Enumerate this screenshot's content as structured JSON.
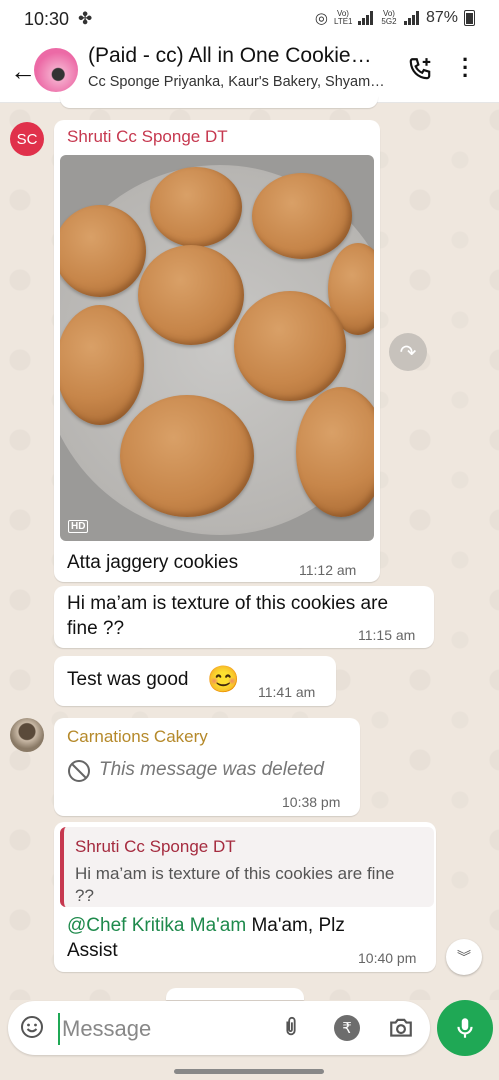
{
  "status_bar": {
    "time": "10:30",
    "battery": "87%",
    "net1": "Vo) LTE1",
    "net2": "Vo) 5G2"
  },
  "header": {
    "title": "(Paid - cc) All in One Cookie…",
    "subtitle": "Cc Sponge Priyanka, Kaur's Bakery, Shyam…"
  },
  "messages": [
    {
      "avatar": "SC",
      "sender": "Shruti Cc Sponge DT",
      "sender_color": "#c6384f",
      "caption": "Atta jaggery cookies",
      "time": "11:12 am",
      "image_badge": "HD"
    },
    {
      "text": "Hi ma’am is texture of this cookies are fine ??",
      "time": "11:15 am"
    },
    {
      "text": "Test was good",
      "emoji": "😊",
      "time": "11:41 am"
    },
    {
      "sender": "Carnations Cakery",
      "sender_color": "#b5892a",
      "deleted_text": "This message was deleted",
      "time": "10:38 pm"
    },
    {
      "quote_sender": "Shruti Cc Sponge DT",
      "quote_text": "Hi ma’am is texture of this cookies are fine ??",
      "mention": "@Chef Kritika Ma'am",
      "text": " Ma'am, Plz Assist",
      "time": "10:40 pm"
    }
  ],
  "input": {
    "placeholder": "Message"
  },
  "colors": {
    "accent": "#1fa855",
    "mention": "#1e8a4c",
    "quote_bar": "#c6384f"
  },
  "icons": [
    "back-arrow-icon",
    "add-call-icon",
    "more-options-icon",
    "forward-icon",
    "hd-badge",
    "deleted-icon",
    "scroll-down-icon",
    "emoji-icon",
    "attach-icon",
    "rupee-payment-icon",
    "camera-icon",
    "mic-icon"
  ]
}
